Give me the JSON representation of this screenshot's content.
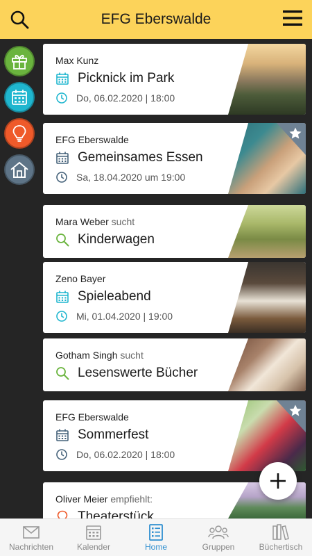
{
  "header": {
    "title": "EFG Eberswalde",
    "search_icon": "search-icon",
    "menu_icon": "hamburger-menu-icon",
    "background": "#fcd35a"
  },
  "sidebar": {
    "items": [
      {
        "name": "gift",
        "icon": "gift-icon",
        "color": "#6ab43e"
      },
      {
        "name": "calendar",
        "icon": "calendar-icon",
        "color": "#1fb6cf"
      },
      {
        "name": "idea",
        "icon": "lightbulb-icon",
        "color": "#ef5a2a"
      },
      {
        "name": "home",
        "icon": "house-icon",
        "color": "#5e7487"
      }
    ]
  },
  "feed": [
    {
      "author": "Max Kunz",
      "verb": "",
      "title": "Picknick im Park",
      "title_icon": "calendar-icon",
      "meta": "Do, 06.02.2020 | 18:00",
      "meta_icon": "clock-icon",
      "starred": false
    },
    {
      "author": "EFG Eberswalde",
      "verb": "",
      "title": "Gemeinsames Essen",
      "title_icon": "calendar-icon",
      "meta": "Sa, 18.04.2020 um 19:00",
      "meta_icon": "clock-icon",
      "starred": true
    },
    {
      "author": "Mara Weber",
      "verb": "sucht",
      "title": "Kinderwagen",
      "title_icon": "search-icon",
      "meta": "",
      "starred": false
    },
    {
      "author": "Zeno Bayer",
      "verb": "",
      "title": "Spieleabend",
      "title_icon": "calendar-icon",
      "meta": "Mi, 01.04.2020 | 19:00",
      "meta_icon": "clock-icon",
      "starred": false
    },
    {
      "author": "Gotham Singh",
      "verb": "sucht",
      "title": "Lesenswerte Bücher",
      "title_icon": "search-icon",
      "meta": "",
      "starred": false
    },
    {
      "author": "EFG Eberswalde",
      "verb": "",
      "title": "Sommerfest",
      "title_icon": "calendar-icon",
      "meta": "Do, 06.02.2020 | 18:00",
      "meta_icon": "clock-icon",
      "starred": true
    },
    {
      "author": "Oliver Meier",
      "verb": "empfiehlt:",
      "title": "Theaterstück",
      "title_icon": "lightbulb-icon",
      "meta": "",
      "starred": false
    }
  ],
  "fab": {
    "icon": "plus-icon"
  },
  "bottom_nav": {
    "items": [
      {
        "label": "Nachrichten",
        "icon": "mail-icon",
        "active": false
      },
      {
        "label": "Kalender",
        "icon": "calendar-icon",
        "active": false
      },
      {
        "label": "Home",
        "icon": "list-icon",
        "active": true
      },
      {
        "label": "Gruppen",
        "icon": "people-icon",
        "active": false
      },
      {
        "label": "Büchertisch",
        "icon": "books-icon",
        "active": false
      }
    ]
  },
  "colors": {
    "accent_blue": "#2f8fd0",
    "event_icon": "#1fb6cf",
    "search_icon": "#6ab43e",
    "clock_icon": "#1fb6cf"
  }
}
